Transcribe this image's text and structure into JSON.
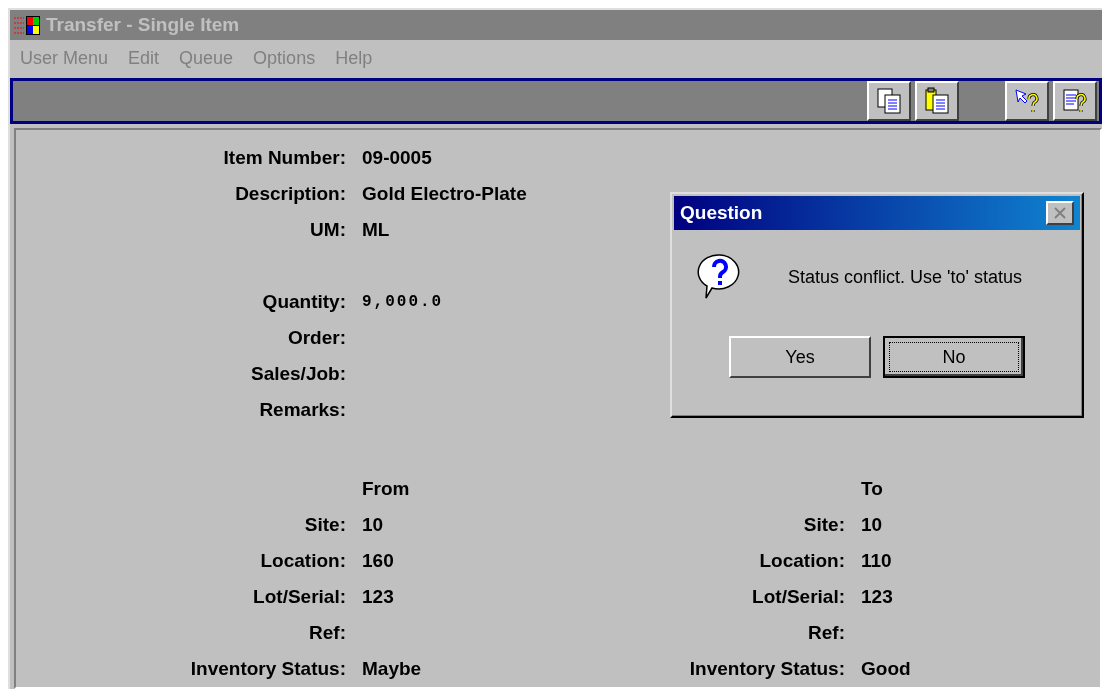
{
  "window": {
    "title": "Transfer - Single Item",
    "active": false
  },
  "menu": [
    {
      "label": "User Menu",
      "disabled": true
    },
    {
      "label": "Edit",
      "disabled": true
    },
    {
      "label": "Queue",
      "disabled": true
    },
    {
      "label": "Options",
      "disabled": true
    },
    {
      "label": "Help",
      "disabled": true
    }
  ],
  "toolbar": [
    {
      "buttons": [
        {
          "kind": "copy"
        },
        {
          "kind": "paste"
        }
      ]
    },
    {
      "buttons": [
        {
          "kind": "help-pointer"
        },
        {
          "kind": "help-doc"
        }
      ]
    }
  ],
  "item_fields": [
    {
      "label": "Item Number:",
      "value": "09-0005"
    },
    {
      "label": "Description:",
      "value": "Gold Electro-Plate"
    },
    {
      "label": "UM:",
      "value": "ML"
    }
  ],
  "detail_fields": [
    {
      "label": "Quantity:",
      "value": "9,000.0",
      "mono": true
    },
    {
      "label": "Order:"
    },
    {
      "label": "Sales/Job:"
    },
    {
      "label": "Remarks:"
    }
  ],
  "from": {
    "heading": "From",
    "fields": [
      {
        "label": "Site:",
        "value": "10"
      },
      {
        "label": "Location:",
        "value": "160"
      },
      {
        "label": "Lot/Serial:",
        "value": "123"
      },
      {
        "label": "Ref:"
      },
      {
        "label": "Inventory Status:",
        "value": "Maybe"
      }
    ]
  },
  "to": {
    "heading": "To",
    "fields": [
      {
        "label": "Site:",
        "value": "10"
      },
      {
        "label": "Location:",
        "value": "110"
      },
      {
        "label": "Lot/Serial:",
        "value": "123"
      },
      {
        "label": "Ref:"
      },
      {
        "label": "Inventory Status:",
        "value": "Good"
      }
    ]
  },
  "dialog": {
    "title": "Question",
    "message": "Status conflict.  Use 'to' status",
    "buttons": [
      {
        "label": "Yes",
        "default": false
      },
      {
        "label": "No",
        "default": true
      }
    ]
  }
}
